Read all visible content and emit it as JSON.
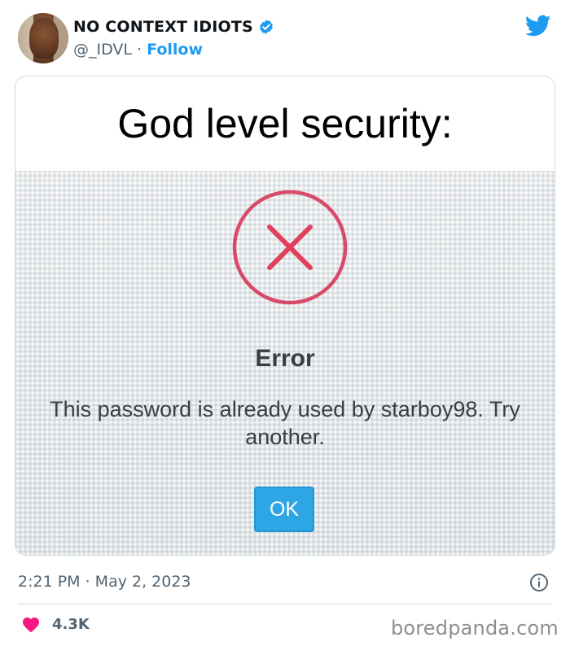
{
  "tweet": {
    "display_name": "NO CONTEXT IDIOTS",
    "handle": "@_IDVL",
    "separator": "·",
    "follow_label": "Follow",
    "caption": "God level security:",
    "timestamp": "2:21 PM · May 2, 2023",
    "like_count": "4.3K"
  },
  "dialog": {
    "title": "Error",
    "message": "This password is already used by starboy98. Try another.",
    "ok_label": "OK"
  },
  "watermark": "boredpanda.com",
  "colors": {
    "accent": "#1d9bf0",
    "heart": "#f91880",
    "error_icon": "#d6385a",
    "ok_button": "#2ea6e6"
  },
  "icons": [
    "verified-badge-icon",
    "twitter-bird-icon",
    "error-x-icon",
    "info-icon",
    "heart-icon"
  ]
}
